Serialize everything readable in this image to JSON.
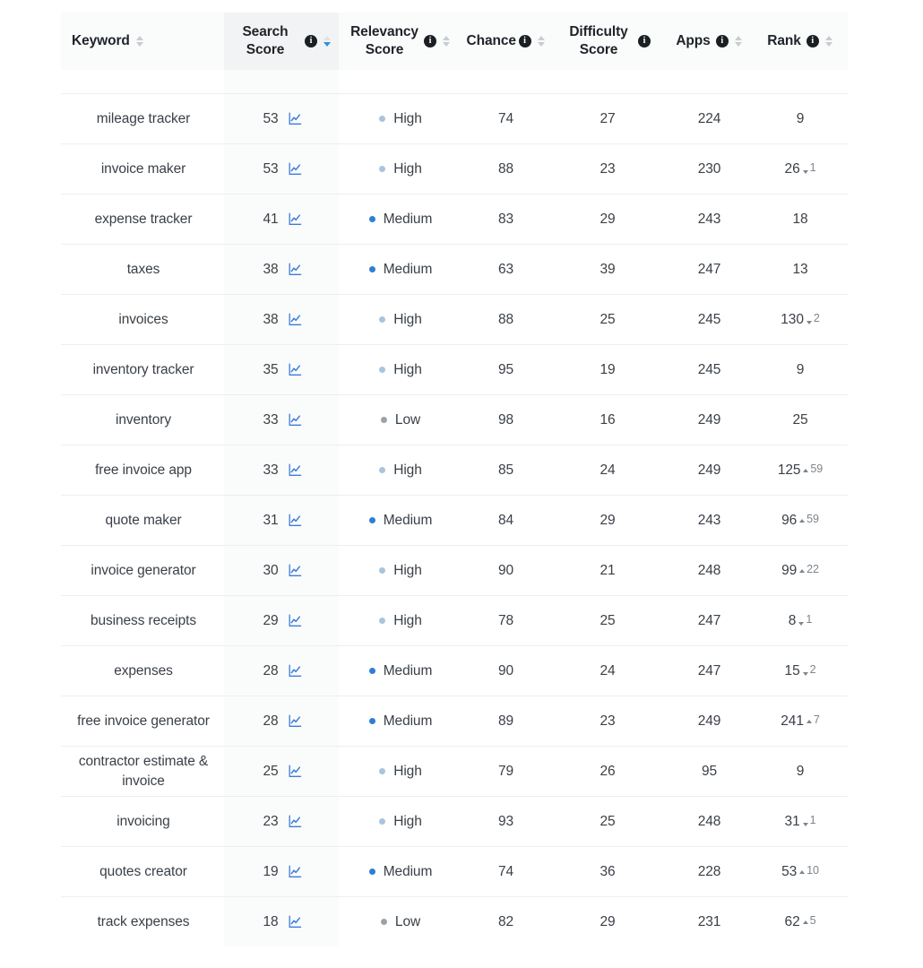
{
  "table": {
    "columns": [
      {
        "key": "keyword",
        "label": "Keyword",
        "align": "left",
        "info": false,
        "sortable": true,
        "sorted": "none"
      },
      {
        "key": "search",
        "label": "Search Score",
        "align": "center",
        "info": true,
        "sortable": true,
        "sorted": "desc"
      },
      {
        "key": "relevancy",
        "label": "Relevancy Score",
        "align": "center",
        "info": true,
        "sortable": true,
        "sorted": "none"
      },
      {
        "key": "chance",
        "label": "Chance",
        "align": "center",
        "info": true,
        "sortable": true,
        "sorted": "none"
      },
      {
        "key": "difficulty",
        "label": "Difficulty Score",
        "align": "center",
        "info": true,
        "sortable": false,
        "sorted": "none"
      },
      {
        "key": "apps",
        "label": "Apps",
        "align": "center",
        "info": true,
        "sortable": true,
        "sorted": "none"
      },
      {
        "key": "rank",
        "label": "Rank",
        "align": "center",
        "info": true,
        "sortable": true,
        "sorted": "none"
      }
    ],
    "info_glyph": "i",
    "chart_icon_name": "line-chart-icon",
    "rows": [
      {
        "keyword": "mileage tracker",
        "search": "53",
        "relevancy": "High",
        "chance": "74",
        "difficulty": "27",
        "apps": "224",
        "rank": "9",
        "delta": "",
        "delta_dir": "none"
      },
      {
        "keyword": "invoice maker",
        "search": "53",
        "relevancy": "High",
        "chance": "88",
        "difficulty": "23",
        "apps": "230",
        "rank": "26",
        "delta": "1",
        "delta_dir": "down"
      },
      {
        "keyword": "expense tracker",
        "search": "41",
        "relevancy": "Medium",
        "chance": "83",
        "difficulty": "29",
        "apps": "243",
        "rank": "18",
        "delta": "",
        "delta_dir": "none"
      },
      {
        "keyword": "taxes",
        "search": "38",
        "relevancy": "Medium",
        "chance": "63",
        "difficulty": "39",
        "apps": "247",
        "rank": "13",
        "delta": "",
        "delta_dir": "none"
      },
      {
        "keyword": "invoices",
        "search": "38",
        "relevancy": "High",
        "chance": "88",
        "difficulty": "25",
        "apps": "245",
        "rank": "130",
        "delta": "2",
        "delta_dir": "down"
      },
      {
        "keyword": "inventory tracker",
        "search": "35",
        "relevancy": "High",
        "chance": "95",
        "difficulty": "19",
        "apps": "245",
        "rank": "9",
        "delta": "",
        "delta_dir": "none"
      },
      {
        "keyword": "inventory",
        "search": "33",
        "relevancy": "Low",
        "chance": "98",
        "difficulty": "16",
        "apps": "249",
        "rank": "25",
        "delta": "",
        "delta_dir": "none"
      },
      {
        "keyword": "free invoice app",
        "search": "33",
        "relevancy": "High",
        "chance": "85",
        "difficulty": "24",
        "apps": "249",
        "rank": "125",
        "delta": "59",
        "delta_dir": "up"
      },
      {
        "keyword": "quote maker",
        "search": "31",
        "relevancy": "Medium",
        "chance": "84",
        "difficulty": "29",
        "apps": "243",
        "rank": "96",
        "delta": "59",
        "delta_dir": "up"
      },
      {
        "keyword": "invoice generator",
        "search": "30",
        "relevancy": "High",
        "chance": "90",
        "difficulty": "21",
        "apps": "248",
        "rank": "99",
        "delta": "22",
        "delta_dir": "up"
      },
      {
        "keyword": "business receipts",
        "search": "29",
        "relevancy": "High",
        "chance": "78",
        "difficulty": "25",
        "apps": "247",
        "rank": "8",
        "delta": "1",
        "delta_dir": "down"
      },
      {
        "keyword": "expenses",
        "search": "28",
        "relevancy": "Medium",
        "chance": "90",
        "difficulty": "24",
        "apps": "247",
        "rank": "15",
        "delta": "2",
        "delta_dir": "down"
      },
      {
        "keyword": "free invoice generator",
        "search": "28",
        "relevancy": "Medium",
        "chance": "89",
        "difficulty": "23",
        "apps": "249",
        "rank": "241",
        "delta": "7",
        "delta_dir": "up"
      },
      {
        "keyword": "contractor estimate & invoice",
        "search": "25",
        "relevancy": "High",
        "chance": "79",
        "difficulty": "26",
        "apps": "95",
        "rank": "9",
        "delta": "",
        "delta_dir": "none"
      },
      {
        "keyword": "invoicing",
        "search": "23",
        "relevancy": "High",
        "chance": "93",
        "difficulty": "25",
        "apps": "248",
        "rank": "31",
        "delta": "1",
        "delta_dir": "down"
      },
      {
        "keyword": "quotes creator",
        "search": "19",
        "relevancy": "Medium",
        "chance": "74",
        "difficulty": "36",
        "apps": "228",
        "rank": "53",
        "delta": "10",
        "delta_dir": "up"
      },
      {
        "keyword": "track expenses",
        "search": "18",
        "relevancy": "Low",
        "chance": "82",
        "difficulty": "29",
        "apps": "231",
        "rank": "62",
        "delta": "5",
        "delta_dir": "up"
      }
    ]
  },
  "colors": {
    "high_dot": "#a9c4de",
    "medium_dot": "#2d7fd3",
    "low_dot": "#9aa3ab",
    "sort_active": "#2d8fe0",
    "header_bg": "#fafbfb",
    "sorted_col_bg": "#f2f3f4",
    "row_border": "#eceef0",
    "chart_icon": "#3b7dd8"
  }
}
